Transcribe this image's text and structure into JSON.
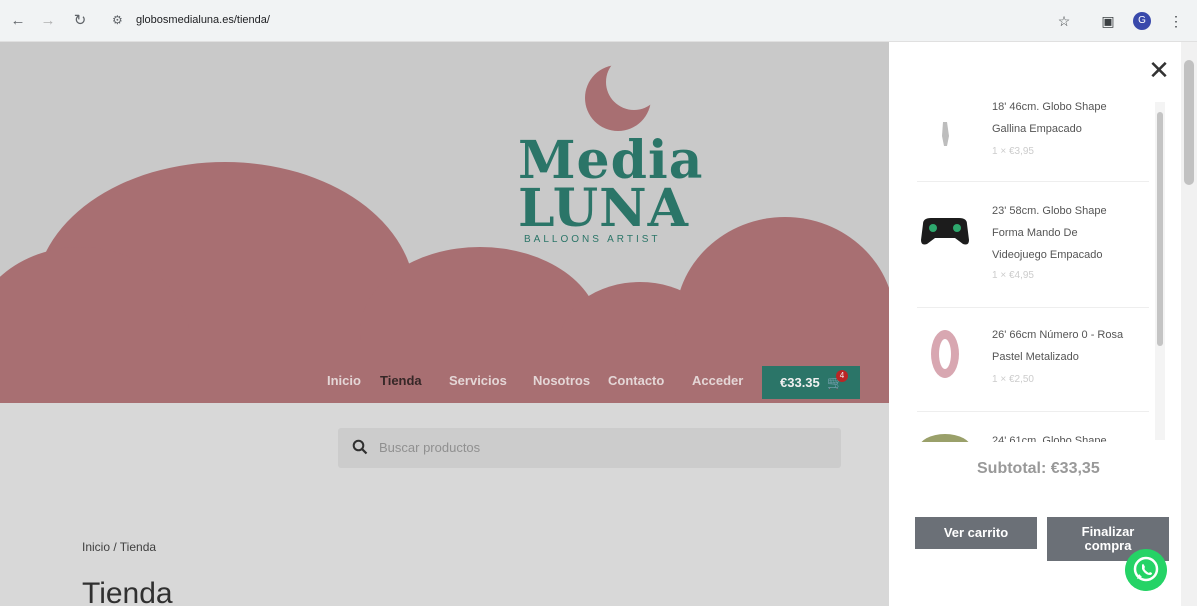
{
  "browser": {
    "url": "globosmedialuna.es/tienda/",
    "profile_initial": "G"
  },
  "site": {
    "logo": {
      "title_line1": "Media",
      "title_line2": "LUNA",
      "subtitle": "BALLOONS ARTIST"
    },
    "menu": [
      {
        "label": "Inicio",
        "active": false
      },
      {
        "label": "Tienda",
        "active": true
      },
      {
        "label": "Servicios",
        "active": false
      },
      {
        "label": "Nosotros",
        "active": false
      },
      {
        "label": "Contacto",
        "active": false
      },
      {
        "label": "Acceder",
        "active": false
      }
    ],
    "cart": {
      "total": "€33.35",
      "count": "4"
    },
    "search_placeholder": "Buscar productos",
    "breadcrumb": "Inicio / Tienda",
    "page_title": "Tienda",
    "colors": {
      "brand_teal": "#2e7d6f",
      "cloud_pink": "#b3767a"
    }
  },
  "cart_drawer": {
    "items": [
      {
        "name": "18' 46cm. Globo Shape Gallina Empacado",
        "qty": "1 × €3,95",
        "icon": "chicken-balloon-icon"
      },
      {
        "name": "23' 58cm. Globo Shape Forma Mando De Videojuego Empacado",
        "qty": "1 × €4,95",
        "icon": "gamepad-balloon-icon"
      },
      {
        "name": "26' 66cm Número 0 - Rosa Pastel Metalizado",
        "qty": "1 × €2,50",
        "icon": "number-zero-balloon-icon"
      },
      {
        "name": "24' 61cm. Globo Shape",
        "qty": "",
        "icon": "balloon-icon"
      }
    ],
    "subtotal_label": "Subtotal:",
    "subtotal_value": "€33,35",
    "view_cart_label": "Ver carrito",
    "checkout_label": "Finalizar compra"
  }
}
